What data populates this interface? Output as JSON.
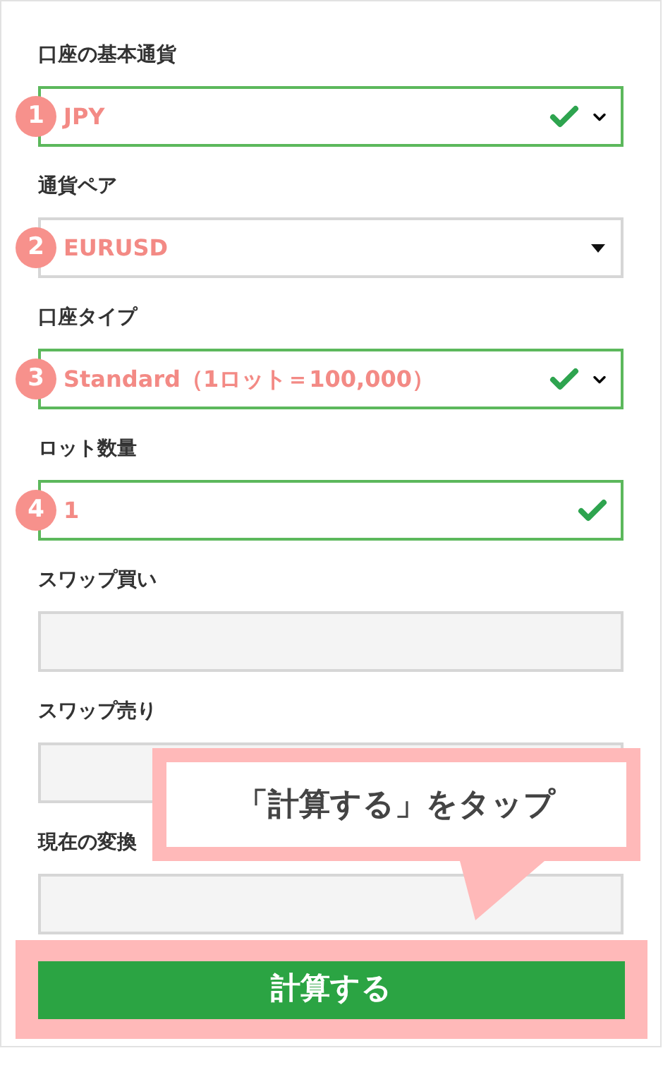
{
  "fields": [
    {
      "label": "口座の基本通貨",
      "badge": "1",
      "value": "JPY",
      "kind": "select",
      "valid": true
    },
    {
      "label": "通貨ペア",
      "badge": "2",
      "value": "EURUSD",
      "kind": "dropdown",
      "valid": false
    },
    {
      "label": "口座タイプ",
      "badge": "3",
      "value": "Standard（1ロット＝100,000）",
      "kind": "select",
      "valid": true
    },
    {
      "label": "ロット数量",
      "badge": "4",
      "value": "1",
      "kind": "input",
      "valid": true
    },
    {
      "label": "スワップ買い",
      "kind": "output",
      "valid": false
    },
    {
      "label": "スワップ売り",
      "kind": "output",
      "valid": false
    },
    {
      "label": "現在の変換",
      "kind": "output",
      "valid": false
    }
  ],
  "callout": {
    "text": "「計算する」をタップ"
  },
  "button": {
    "label": "計算する",
    "highlighted": true
  }
}
